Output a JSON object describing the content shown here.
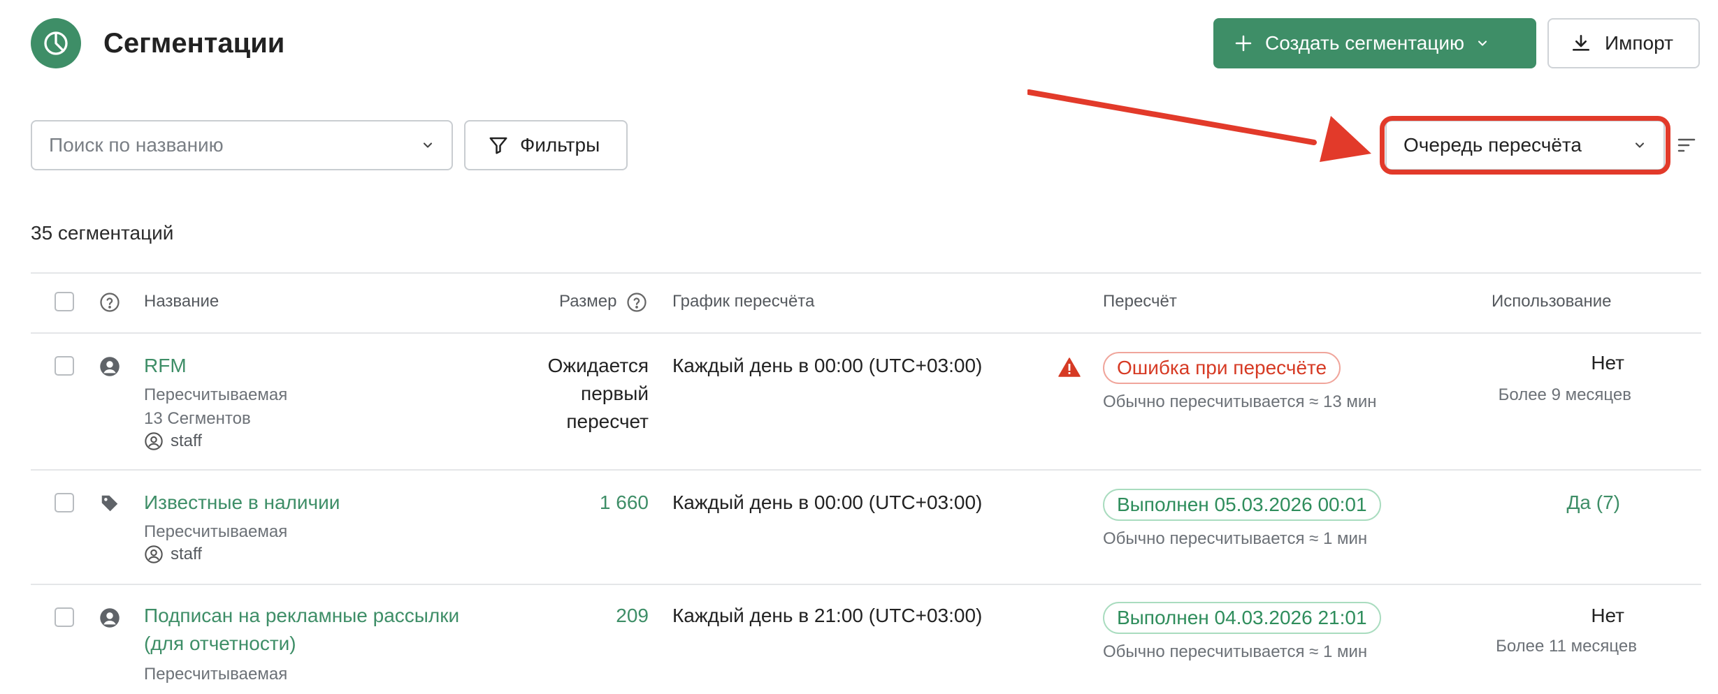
{
  "header": {
    "title": "Сегментации",
    "create_label": "Создать сегментацию",
    "import_label": "Импорт"
  },
  "toolbar": {
    "search_placeholder": "Поиск по названию",
    "filters_label": "Фильтры",
    "sort_value": "Очередь пересчёта"
  },
  "count_label": "35 сегментаций",
  "table": {
    "columns": {
      "name": "Название",
      "size": "Размер",
      "schedule": "График пересчёта",
      "recalc": "Пересчёт",
      "usage": "Использование"
    },
    "rows": [
      {
        "name": "RFM",
        "type": "Пересчитываемая",
        "segments": "13 Сегментов",
        "owner": "staff",
        "size_lines": [
          "Ожидается",
          "первый",
          "пересчет"
        ],
        "schedule": "Каждый день в 00:00 (UTC+03:00)",
        "status": "Ошибка при пересчёте",
        "recalc_note": "Обычно пересчитывается ≈ 13 мин",
        "usage": "Нет",
        "usage_note": "Более 9 месяцев"
      },
      {
        "name": "Известные в наличии",
        "type": "Пересчитываемая",
        "owner": "staff",
        "size": "1 660",
        "schedule": "Каждый день в 00:00 (UTC+03:00)",
        "status": "Выполнен 05.03.2026 00:01",
        "recalc_note": "Обычно пересчитывается ≈ 1 мин",
        "usage": "Да (7)"
      },
      {
        "name_line1": "Подписан на рекламные рассылки",
        "name_line2": "(для отчетности)",
        "type": "Пересчитываемая",
        "size": "209",
        "schedule": "Каждый день в 21:00 (UTC+03:00)",
        "status": "Выполнен 04.03.2026 21:01",
        "recalc_note": "Обычно пересчитывается ≈ 1 мин",
        "usage": "Нет",
        "usage_note": "Более 11 месяцев"
      }
    ]
  },
  "colors": {
    "brand": "#3e8e67",
    "error": "#d63a24",
    "success": "#2f8d5c",
    "annotation": "#e23a2a"
  }
}
